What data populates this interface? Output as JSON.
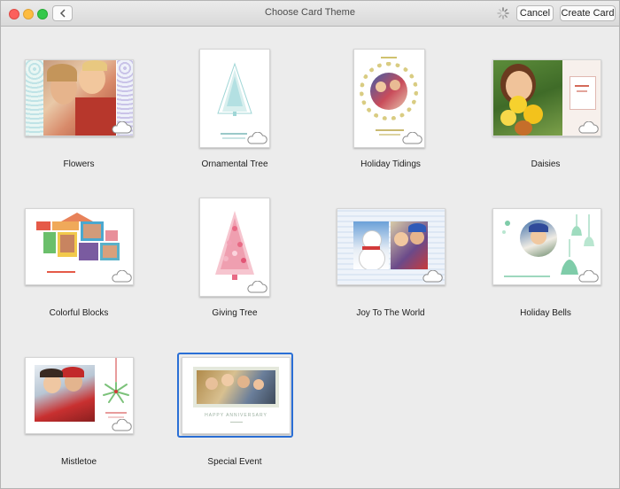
{
  "window": {
    "title": "Choose Card Theme",
    "buttons": {
      "cancel": "Cancel",
      "create": "Create Card"
    }
  },
  "themes": [
    {
      "name": "Flowers"
    },
    {
      "name": "Ornamental Tree"
    },
    {
      "name": "Holiday Tidings"
    },
    {
      "name": "Daisies"
    },
    {
      "name": "Colorful Blocks"
    },
    {
      "name": "Giving Tree"
    },
    {
      "name": "Joy To The World"
    },
    {
      "name": "Holiday Bells"
    },
    {
      "name": "Mistletoe"
    },
    {
      "name": "Special Event"
    }
  ],
  "selected_theme": "Special Event",
  "special_event_text": "HAPPY ANNIVERSARY",
  "icons": {
    "back": "chevron-left-icon",
    "spinner": "spinner-icon",
    "cloud": "cloud-icon"
  },
  "colors": {
    "selection": "#2a6fd6"
  }
}
